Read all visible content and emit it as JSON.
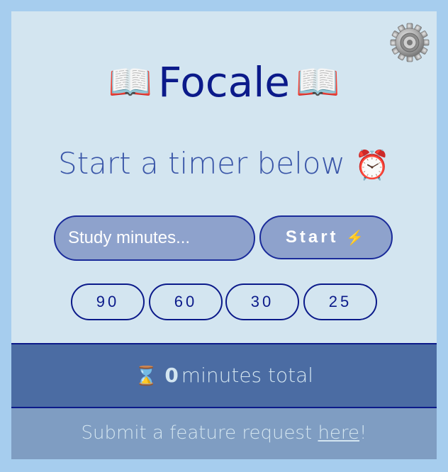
{
  "app": {
    "title": "Focale",
    "title_emoji": "📖",
    "settings_icon": "gear-icon"
  },
  "timer": {
    "subtitle": "Start a timer below",
    "subtitle_emoji": "⏰",
    "input_placeholder": "Study minutes...",
    "start_label": "Start",
    "start_emoji": "⚡",
    "presets": [
      "90",
      "60",
      "30",
      "25"
    ]
  },
  "stats": {
    "hourglass_emoji": "⌛",
    "total_minutes": "0",
    "suffix": "minutes total"
  },
  "footer": {
    "text": "Submit a feature request ",
    "link_label": "here",
    "trailing": "!"
  },
  "colors": {
    "background": "#a6cdee",
    "panel": "#d3e5f0",
    "accent": "#0b1a8a",
    "button_fill": "#8ea2cc",
    "total_bar": "#4b6ca3",
    "footer_bar": "#7f9dc2"
  }
}
